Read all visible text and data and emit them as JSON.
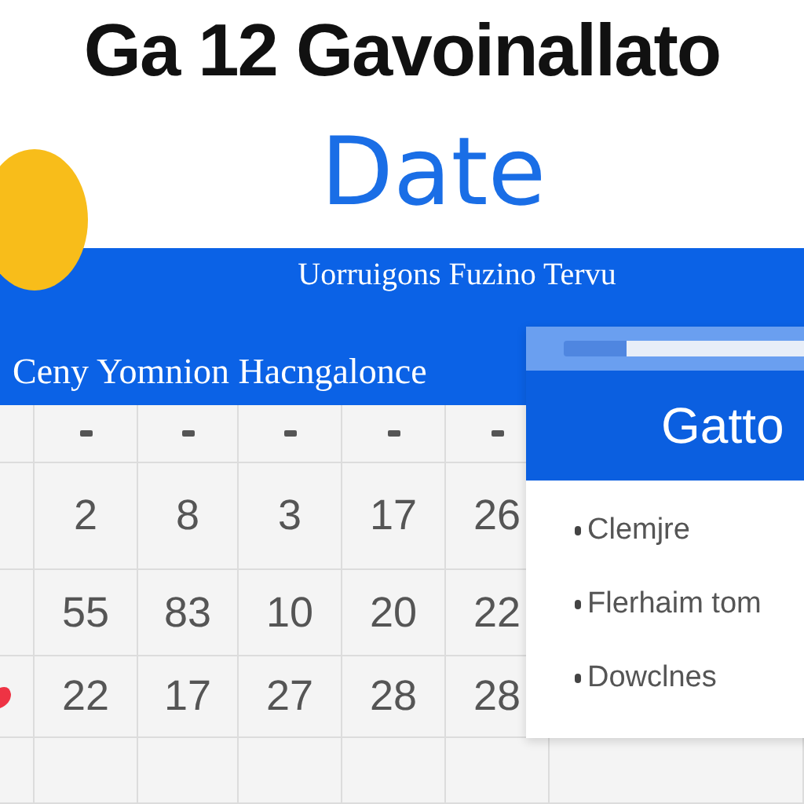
{
  "title": "Ga 12 Gavoinallato",
  "heading": "Date",
  "banner": {
    "subtitle": "Uorruigons Fuzino Tervu",
    "line": "Ceny Yomnion Hacngalonce"
  },
  "calendar": {
    "rows": [
      {
        "marked": false,
        "cells": [
          "2",
          "8",
          "3",
          "17",
          "26"
        ]
      },
      {
        "marked": false,
        "cells": [
          "55",
          "83",
          "10",
          "20",
          "22"
        ]
      },
      {
        "marked": true,
        "cells": [
          "22",
          "17",
          "27",
          "28",
          "28"
        ]
      }
    ]
  },
  "panel": {
    "header": "Gatto",
    "items": [
      "Clemjre",
      "Flerhaim tom",
      "Dowclnes"
    ]
  }
}
